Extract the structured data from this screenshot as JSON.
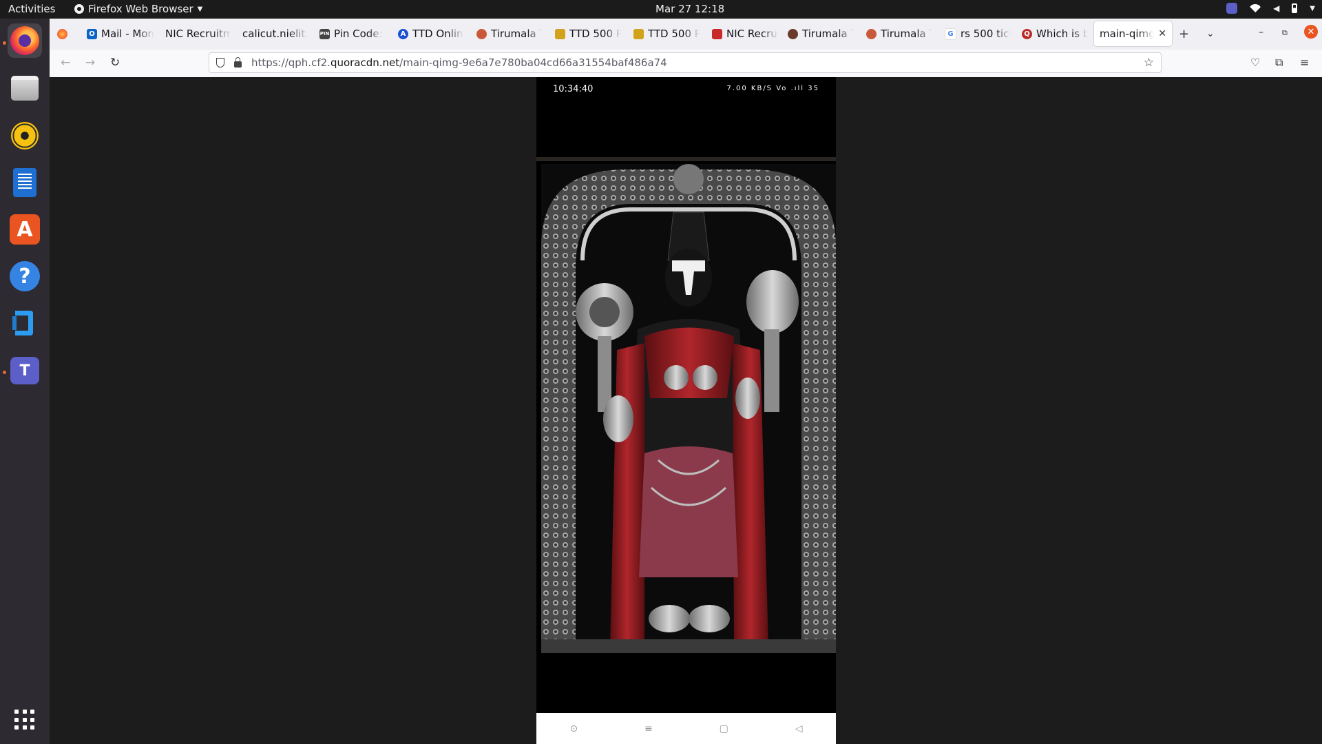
{
  "topbar": {
    "activities": "Activities",
    "app_name": "Firefox Web Browser",
    "clock": "Mar 27  12:18"
  },
  "dock": {
    "items": [
      "firefox",
      "files",
      "rhythmbox",
      "libreoffice-writer",
      "app-center",
      "help",
      "vscode",
      "teams",
      "show-applications"
    ]
  },
  "tabs": [
    {
      "label": "Mail - Mon",
      "icon": "outlook-icon",
      "color": "#0a64c8"
    },
    {
      "label": "NIC Recruitm",
      "icon": "none"
    },
    {
      "label": "calicut.nielit.",
      "icon": "none"
    },
    {
      "label": "Pin Code: ",
      "icon": "pin-icon",
      "favtext": "PIN"
    },
    {
      "label": "TTD Onlin",
      "icon": "ttd-online-icon",
      "color": "#1a4fd6",
      "favtext": "A"
    },
    {
      "label": "Tirumala T",
      "icon": "tirumala-icon",
      "color": "#c85a3a"
    },
    {
      "label": "TTD 500 R",
      "icon": "ttd-icon",
      "color": "#d1a21a"
    },
    {
      "label": "TTD 500 R",
      "icon": "ttd-icon",
      "color": "#d1a21a"
    },
    {
      "label": "NIC Recrui",
      "icon": "nic-icon",
      "color": "#c82a2a"
    },
    {
      "label": "Tirumala T",
      "icon": "tirumala-icon",
      "color": "#6a3a2a"
    },
    {
      "label": "Tirumala T",
      "icon": "tirumala-icon",
      "color": "#c85a3a"
    },
    {
      "label": "rs 500 tick",
      "icon": "google-icon",
      "color": "#4285f4",
      "favtext": "G"
    },
    {
      "label": "Which is b",
      "icon": "quora-icon",
      "color": "#b92b27",
      "favtext": "Q"
    },
    {
      "label": "main-qimg-",
      "icon": "none",
      "selected": true
    }
  ],
  "navbar": {
    "url_prefix": "https://qph.cf2.",
    "url_host": "quoracdn.net",
    "url_path": "/main-qimg-9e6a7e780ba04cd66a31554baf486a74"
  },
  "phone": {
    "time": "10:34:40",
    "status_icons": "7.00 KB/S  Vo  .ıll  35"
  },
  "colors": {
    "firefox_chrome": "#f0f0f4",
    "page_bg": "#1c1c1c",
    "ubuntu_orange": "#e95420"
  }
}
